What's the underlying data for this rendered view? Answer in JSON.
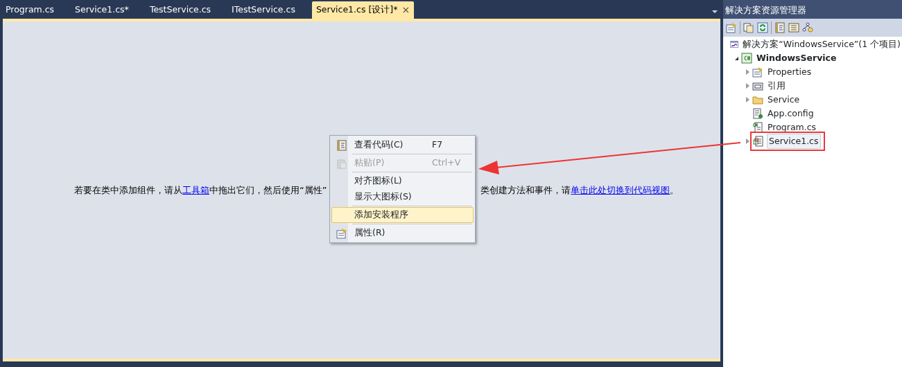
{
  "tabs": [
    {
      "label": "Program.cs",
      "selected": false
    },
    {
      "label": "Service1.cs*",
      "selected": false
    },
    {
      "label": "TestService.cs",
      "selected": false
    },
    {
      "label": "ITestService.cs",
      "selected": false
    },
    {
      "label": "Service1.cs [设计]*",
      "selected": true,
      "close": "×"
    }
  ],
  "designer": {
    "note_left": [
      {
        "kind": "text",
        "text": "若要在类中添加组件，请从"
      },
      {
        "kind": "link",
        "text": "工具箱"
      },
      {
        "kind": "text",
        "text": "中拖出它们，然后使用“属性”"
      }
    ],
    "note_right": [
      {
        "kind": "text",
        "text": "类创建方法和事件，请"
      },
      {
        "kind": "link",
        "text": "单击此处切换到代码视图"
      },
      {
        "kind": "text",
        "text": "。"
      }
    ]
  },
  "context_menu": [
    {
      "kind": "item",
      "label": "查看代码(C)",
      "shortcut": "F7",
      "disabled": false,
      "selected": false
    },
    {
      "kind": "separator"
    },
    {
      "kind": "item",
      "label": "粘贴(P)",
      "shortcut": "Ctrl+V",
      "disabled": true,
      "selected": false
    },
    {
      "kind": "separator"
    },
    {
      "kind": "item",
      "label": "对齐图标(L)",
      "disabled": false,
      "selected": false
    },
    {
      "kind": "item",
      "label": "显示大图标(S)",
      "disabled": false,
      "selected": false
    },
    {
      "kind": "separator"
    },
    {
      "kind": "item",
      "label": "添加安装程序",
      "disabled": false,
      "selected": true
    },
    {
      "kind": "separator"
    },
    {
      "kind": "item",
      "label": "属性(R)",
      "disabled": false,
      "selected": false
    }
  ],
  "solution_explorer": {
    "title": "解决方案资源管理器",
    "tree": [
      {
        "label": "解决方案“WindowsService”(1 个项目)",
        "selected": false,
        "children": [
          {
            "label": "WindowsService",
            "expanded": true,
            "selected": false,
            "children": [
              {
                "label": "Properties",
                "expanded": false,
                "selected": false
              },
              {
                "label": "引用",
                "expanded": false,
                "selected": false
              },
              {
                "label": "Service",
                "expanded": false,
                "selected": false
              },
              {
                "label": "App.config",
                "selected": false
              },
              {
                "label": "Program.cs",
                "selected": false
              },
              {
                "label": "Service1.cs",
                "expanded": false,
                "selected": true,
                "highlighted": true
              }
            ]
          }
        ]
      }
    ]
  }
}
